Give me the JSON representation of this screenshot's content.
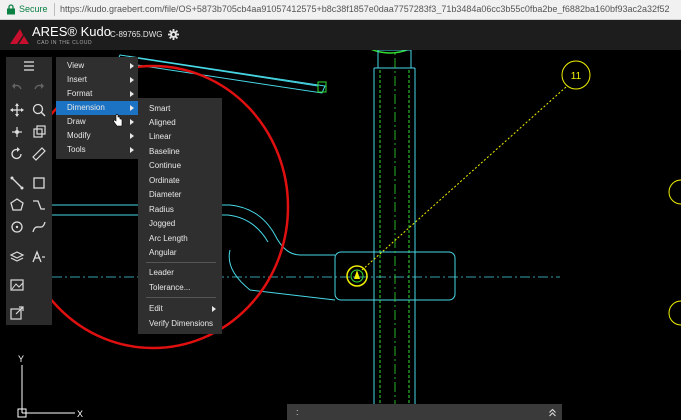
{
  "browser": {
    "secure_label": "Secure",
    "url": "https://kudo.graebert.com/file/OS+5873b705cb4aa91057412575+b8c38f1857e0daa7757283f3_71b3484a06cc3b55c0fba2be_f6882ba160bf93ac2a32f52"
  },
  "app": {
    "logo_title": "ARES® Kudo",
    "logo_subtitle": "CAD IN THE CLOUD",
    "file_name": "C-89765.DWG"
  },
  "menu": {
    "items": [
      {
        "label": "View",
        "has_submenu": true
      },
      {
        "label": "Insert",
        "has_submenu": true
      },
      {
        "label": "Format",
        "has_submenu": true
      },
      {
        "label": "Dimension",
        "has_submenu": true,
        "highlighted": true
      },
      {
        "label": "Draw",
        "has_submenu": true
      },
      {
        "label": "Modify",
        "has_submenu": true
      },
      {
        "label": "Tools",
        "has_submenu": true
      }
    ]
  },
  "dimension_menu": {
    "items": [
      {
        "label": "Smart"
      },
      {
        "label": "Aligned"
      },
      {
        "label": "Linear"
      },
      {
        "label": "Baseline"
      },
      {
        "label": "Continue"
      },
      {
        "label": "Ordinate"
      },
      {
        "label": "Diameter"
      },
      {
        "label": "Radius"
      },
      {
        "label": "Jogged"
      },
      {
        "label": "Arc Length"
      },
      {
        "label": "Angular"
      },
      {
        "label": "Leader"
      },
      {
        "label": "Tolerance..."
      },
      {
        "label": "Edit",
        "has_submenu": true
      },
      {
        "label": "Verify Dimensions"
      }
    ]
  },
  "drawing": {
    "balloon_label": "11",
    "ucs_x": "X",
    "ucs_y": "Y"
  },
  "command_line": {
    "prompt": ":"
  },
  "colors": {
    "accent_highlight": "#1c73c4",
    "annotation_circle": "#e01010",
    "cad_cyan": "#48d8e6",
    "cad_green": "#33dd33",
    "cad_yellow": "#f0f000"
  },
  "icons": [
    "lock-icon",
    "logo-icon",
    "gear-icon",
    "hamburger-icon",
    "undo-icon",
    "redo-icon",
    "pan-icon",
    "zoom-icon",
    "move-icon",
    "copy-icon",
    "rotate-icon",
    "measure-icon",
    "line-icon",
    "rectangle-icon",
    "polygon-icon",
    "polyline-icon",
    "circle-icon",
    "spline-icon",
    "layer-icon",
    "text-icon",
    "image-icon",
    "export-icon",
    "expand-icon"
  ]
}
